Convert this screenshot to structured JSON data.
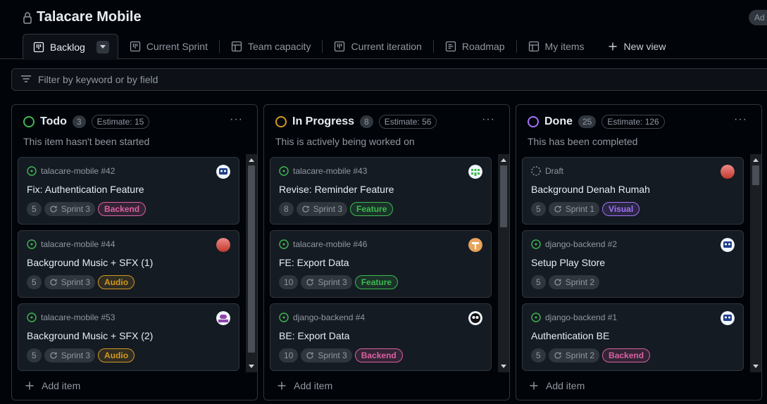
{
  "project": {
    "title": "Talacare Mobile",
    "badge": "Ad"
  },
  "tabs": [
    {
      "label": "Backlog",
      "icon": "board-icon"
    },
    {
      "label": "Current Sprint",
      "icon": "board-icon"
    },
    {
      "label": "Team capacity",
      "icon": "table-icon"
    },
    {
      "label": "Current iteration",
      "icon": "board-icon"
    },
    {
      "label": "Roadmap",
      "icon": "roadmap-icon"
    },
    {
      "label": "My items",
      "icon": "table-icon"
    },
    {
      "label": "New view",
      "icon": "plus-icon"
    }
  ],
  "filter": {
    "placeholder": "Filter by keyword or by field"
  },
  "colors": {
    "todo": "#3fb950",
    "in_progress": "#d29922",
    "done": "#a371f7",
    "backend": "#db61a2",
    "feature": "#3fb950",
    "audio": "#d29922",
    "visual": "#a371f7"
  },
  "columns": [
    {
      "name": "Todo",
      "count": "3",
      "estimate": "Estimate: 15",
      "description": "This item hasn't been started",
      "add_label": "Add item",
      "cards": [
        {
          "repo": "talacare-mobile #42",
          "title": "Fix: Authentication Feature",
          "points": "5",
          "sprint": "Sprint 3",
          "label": "Backend"
        },
        {
          "repo": "talacare-mobile #44",
          "title": "Background Music + SFX (1)",
          "points": "5",
          "sprint": "Sprint 3",
          "label": "Audio"
        },
        {
          "repo": "talacare-mobile #53",
          "title": "Background Music + SFX (2)",
          "points": "5",
          "sprint": "Sprint 3",
          "label": "Audio"
        }
      ]
    },
    {
      "name": "In Progress",
      "count": "8",
      "estimate": "Estimate: 56",
      "description": "This is actively being worked on",
      "add_label": "Add item",
      "cards": [
        {
          "repo": "talacare-mobile #43",
          "title": "Revise: Reminder Feature",
          "points": "8",
          "sprint": "Sprint 3",
          "label": "Feature"
        },
        {
          "repo": "talacare-mobile #46",
          "title": "FE: Export Data",
          "points": "10",
          "sprint": "Sprint 3",
          "label": "Feature"
        },
        {
          "repo": "django-backend #4",
          "title": "BE: Export Data",
          "points": "10",
          "sprint": "Sprint 3",
          "label": "Backend"
        }
      ]
    },
    {
      "name": "Done",
      "count": "25",
      "estimate": "Estimate: 126",
      "description": "This has been completed",
      "add_label": "Add item",
      "cards": [
        {
          "repo": "Draft",
          "title": "Background Denah Rumah",
          "points": "5",
          "sprint": "Sprint 1",
          "label": "Visual"
        },
        {
          "repo": "django-backend #2",
          "title": "Setup Play Store",
          "points": "5",
          "sprint": "Sprint 2",
          "label": ""
        },
        {
          "repo": "django-backend #1",
          "title": "Authentication BE",
          "points": "5",
          "sprint": "Sprint 2",
          "label": "Backend"
        }
      ]
    }
  ]
}
